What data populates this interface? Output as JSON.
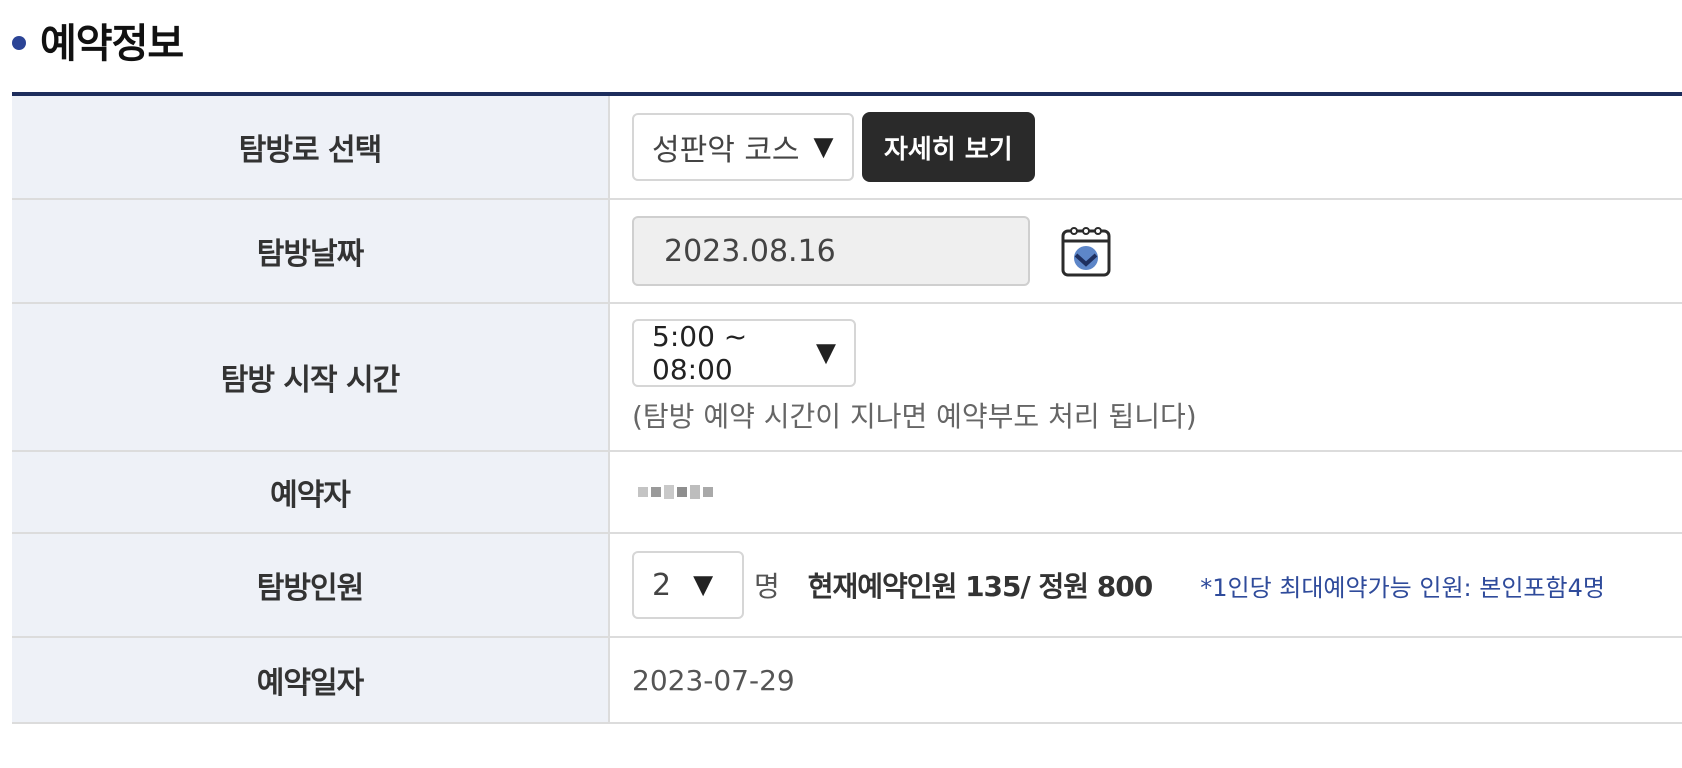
{
  "section": {
    "title": "예약정보"
  },
  "rows": {
    "course": {
      "label": "탐방로 선택",
      "selected": "성판악 코스",
      "detail_button": "자세히 보기"
    },
    "date": {
      "label": "탐방날짜",
      "value": "2023.08.16"
    },
    "start_time": {
      "label": "탐방 시작 시간",
      "selected": "5:00 ~ 08:00",
      "note": "(탐방 예약 시간이 지나면 예약부도 처리 됩니다)"
    },
    "reserver": {
      "label": "예약자"
    },
    "headcount": {
      "label": "탐방인원",
      "selected": "2",
      "unit": "명",
      "status": "현재예약인원 135/ 정원 800",
      "limit_note": "*1인당 최대예약가능 인원: 본인포함4명"
    },
    "reserved_on": {
      "label": "예약일자",
      "value": "2023-07-29"
    }
  },
  "icons": {
    "dropdown": "triangle-down",
    "calendar": "calendar-icon"
  },
  "colors": {
    "accent": "#2b4496",
    "header_border": "#1d2d5c",
    "label_bg": "#eef1f7",
    "button_dark": "#2a2a2a",
    "note_blue": "#2f4b9b"
  }
}
